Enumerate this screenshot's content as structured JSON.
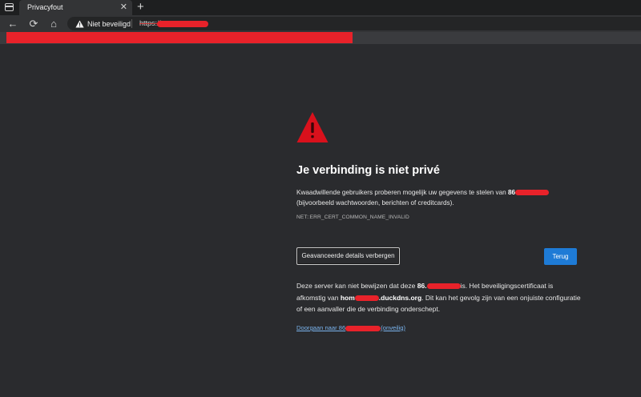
{
  "browser": {
    "tab_title": "Privacyfout",
    "tab_close": "✕",
    "new_tab": "+",
    "back_icon": "←",
    "reload_icon": "⟳",
    "home_icon": "⌂",
    "security_label": "Niet beveiligd",
    "url_prefix": "https://"
  },
  "error_page": {
    "title": "Je verbinding is niet privé",
    "description_part1": "Kwaadwillende gebruikers proberen mogelijk uw gegevens te stelen van ",
    "description_host": "86",
    "description_part2": "(bijvoorbeeld wachtwoorden, berichten of creditcards).",
    "error_code": "NET::ERR_CERT_COMMON_NAME_INVALID",
    "advanced_button": "Geavanceerde details verbergen",
    "back_button": "Terug",
    "details_part1": "Deze server kan niet bewijzen dat deze ",
    "details_host": "86.",
    "details_part2": "is. Het beveiligingscertificaat is afkomstig van ",
    "details_cert_host_start": "hom",
    "details_cert_host_end": ".duckdns.org",
    "details_part3": ". Dit kan het gevolg zijn van een onjuiste configuratie of een aanvaller die de verbinding onderschept.",
    "proceed_prefix": "Doorgaan naar 86",
    "proceed_suffix": "(onveilig)"
  },
  "colors": {
    "background": "#2a2b2e",
    "warning_red": "#d9111c",
    "primary_blue": "#1e7bd6",
    "link": "#7ab4ee"
  }
}
